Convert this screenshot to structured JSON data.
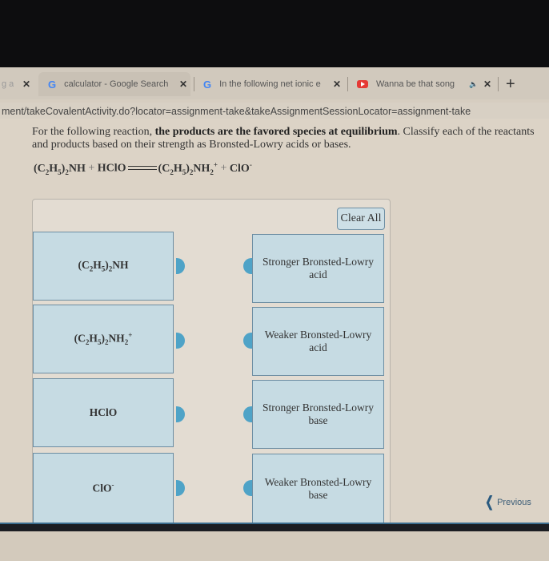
{
  "browser": {
    "tabs": [
      {
        "label": "g a",
        "icon": "none",
        "close": "✕"
      },
      {
        "label": "calculator - Google Search",
        "icon": "google-icon",
        "close": "✕"
      },
      {
        "label": "In the following net ionic e",
        "icon": "google-icon",
        "close": "✕"
      },
      {
        "label": "Wanna be that song",
        "icon": "youtube-icon",
        "close": "✕",
        "audio": "🔈"
      }
    ],
    "new_tab": "+",
    "google_glyph": "G",
    "url": "ment/takeCovalentActivity.do?locator=assignment-take&takeAssignmentSessionLocator=assignment-take"
  },
  "question": {
    "text_before": "For the following reaction, ",
    "text_bold": "the products are the favored species at equilibrium",
    "text_after": ". Classify each of the reactants and products based on their strength as Bronsted-Lowry acids or bases."
  },
  "equation": {
    "r1": {
      "a": "(C",
      "s1": "2",
      "b": "H",
      "s2": "5",
      "c": ")",
      "s3": "2",
      "d": "NH"
    },
    "plus1": "+",
    "r2": "HClO",
    "p1": {
      "a": "(C",
      "s1": "2",
      "b": "H",
      "s2": "5",
      "c": ")",
      "s3": "2",
      "d": "NH",
      "s4": "2",
      "sup": "+"
    },
    "plus2": "+",
    "p2": {
      "a": "ClO",
      "sup": "-"
    }
  },
  "activity": {
    "clear_all": "Clear All",
    "species": [
      {
        "a": "(C",
        "s1": "2",
        "b": "H",
        "s2": "5",
        "c": ")",
        "s3": "2",
        "d": "NH"
      },
      {
        "a": "(C",
        "s1": "2",
        "b": "H",
        "s2": "5",
        "c": ")",
        "s3": "2",
        "d": "NH",
        "s4": "2",
        "sup": "+"
      },
      {
        "a": "HClO"
      },
      {
        "a": "ClO",
        "sup": "-"
      }
    ],
    "categories": [
      {
        "l1": "Stronger Bronsted-Lowry",
        "l2": "acid"
      },
      {
        "l1": "Weaker Bronsted-Lowry",
        "l2": "acid"
      },
      {
        "l1": "Stronger Bronsted-Lowry",
        "l2": "base"
      },
      {
        "l1": "Weaker Bronsted-Lowry",
        "l2": "base"
      }
    ]
  },
  "navigation": {
    "previous": "Previous",
    "previous_glyph": "❮"
  },
  "colors": {
    "item_bg": "#c6dbe3",
    "item_border": "#6d8ea3",
    "connector": "#4fa3c7"
  }
}
